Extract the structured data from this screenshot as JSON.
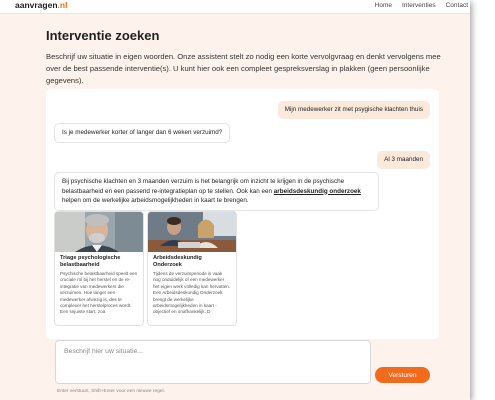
{
  "brand": {
    "name": "aanvragen",
    "tld": ".nl",
    "accent": "#f26b1d"
  },
  "nav": {
    "items": [
      "Home",
      "Interventies",
      "Contact"
    ]
  },
  "page": {
    "title": "Interventie zoeken",
    "intro": "Beschrijf uw situatie in eigen woorden. Onze assistent stelt zo nodig een korte vervolgvraag en denkt vervolgens mee over de best passende interventie(s). U kunt hier ook een compleet gespreksverslag in plakken (geen persoonlijke gegevens)."
  },
  "chat": {
    "messages": [
      {
        "role": "user",
        "text": "Mijn medewerker zit met psygische klachten thuis"
      },
      {
        "role": "assistant",
        "text": "Is je medewerker korter of langer dan 6 weken verzuimd?"
      },
      {
        "role": "user",
        "text": "Al 3 maanden"
      },
      {
        "role": "assistant",
        "text_before": "Bij psychische klachten en 3 maanden verzuim is het belangrijk om inzicht te krijgen in de psychische belastbaarheid en een passend re-integratieplan op te stellen. Ook kan een ",
        "link": "arbeidsdeskundig onderzoek",
        "text_after": " helpen om de werkelijke arbeidsmogelijkheden in kaart te brengen."
      }
    ],
    "cards": [
      {
        "title": "Triage psychologische belastbaarheid",
        "body": "Psychische belastbaarheid speelt een cruciale rol bij het herstel en de re-integratie van medewerkers die verzuimen. Hoe langer een medewerker afwezig is, des te complexer het herstelproces wordt. Een snjuiste start, zoa"
      },
      {
        "title": "Arbeidsdeskundig Onderzoek",
        "body": "Tijdens de verzuimperiode is vaak nog onduidelijk of een medewerker het eigen werk volledig kan hervatten. Een Arbeidsdeskundig Onderzoek brengt de werkelijke arbeidsmogelijkheden in kaart - objectief en onafhankelijk. D"
      }
    ]
  },
  "composer": {
    "placeholder": "Beschrijf hier uw situatie...",
    "send_label": "Versturen",
    "hint": "Enter verstuurt, Shift+Enter voor een nieuwe regel."
  }
}
